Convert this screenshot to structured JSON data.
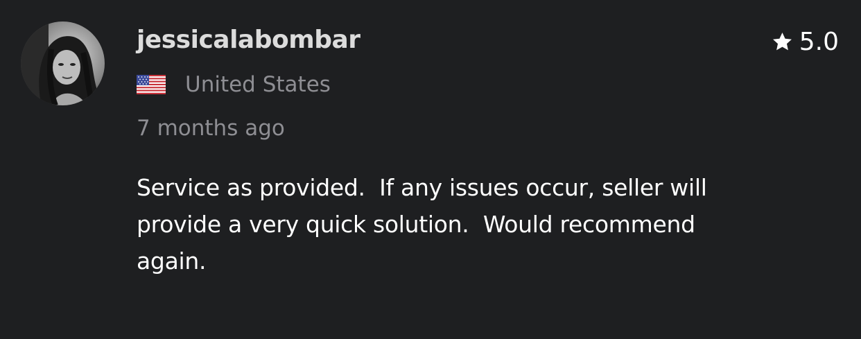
{
  "review": {
    "username": "jessicalabombar",
    "rating": "5.0",
    "rating_icon": "star-icon",
    "country": "United States",
    "flag_icon": "us-flag-icon",
    "time_ago": "7 months ago",
    "text": "Service as provided.  If any issues occur, seller will\nprovide a very quick solution.  Would recommend\nagain."
  },
  "colors": {
    "background": "#1e1f21",
    "username": "#dcdcdc",
    "secondary_text": "#8e8e93",
    "primary_text": "#ffffff"
  }
}
